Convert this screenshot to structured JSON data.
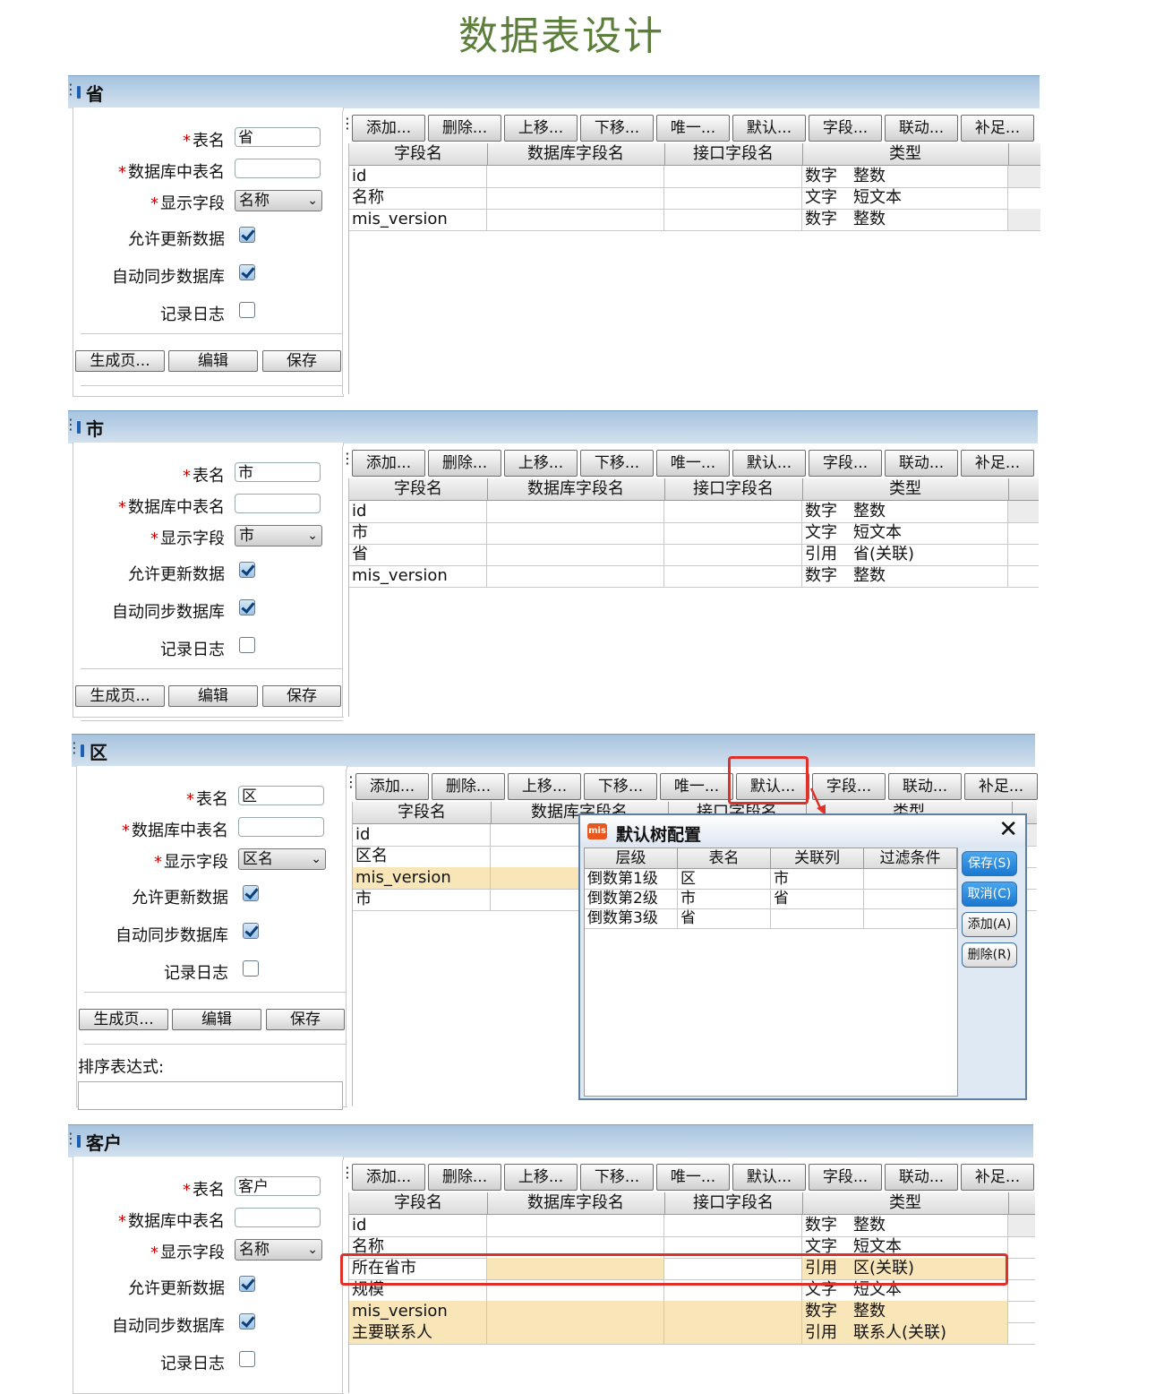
{
  "page_title": "数据表设计",
  "toolbar_buttons": [
    "添加...",
    "删除...",
    "上移...",
    "下移...",
    "唯一...",
    "默认...",
    "字段...",
    "联动...",
    "补足..."
  ],
  "form_labels": {
    "table_name": "表名",
    "db_table_name": "数据库中表名",
    "display_field": "显示字段",
    "allow_update": "允许更新数据",
    "auto_sync": "自动同步数据库",
    "log": "记录日志"
  },
  "bottom_buttons": {
    "generate": "生成页...",
    "edit": "编辑",
    "save": "保存"
  },
  "grid_headers": [
    "字段名",
    "数据库字段名",
    "接口字段名",
    "类型"
  ],
  "panels": [
    {
      "title": "省",
      "table_name": "省",
      "db_table_name": "",
      "display_field": "名称",
      "allow_update": true,
      "auto_sync": true,
      "log": false,
      "rows": [
        {
          "field": "id",
          "type": "数字　整数"
        },
        {
          "field": "名称",
          "type": "文字　短文本"
        },
        {
          "field": "mis_version",
          "type": "数字　整数"
        }
      ]
    },
    {
      "title": "市",
      "table_name": "市",
      "db_table_name": "",
      "display_field": "市",
      "allow_update": true,
      "auto_sync": true,
      "log": false,
      "rows": [
        {
          "field": "id",
          "type": "数字　整数"
        },
        {
          "field": "市",
          "type": "文字　短文本"
        },
        {
          "field": "省",
          "type": "引用　省(关联)"
        },
        {
          "field": "mis_version",
          "type": "数字　整数"
        }
      ]
    },
    {
      "title": "区",
      "table_name": "区",
      "db_table_name": "",
      "display_field": "区名",
      "allow_update": true,
      "auto_sync": true,
      "log": false,
      "sort_label": "排序表达式:",
      "rows": [
        {
          "field": "id"
        },
        {
          "field": "区名"
        },
        {
          "field": "mis_version"
        },
        {
          "field": "市"
        }
      ]
    },
    {
      "title": "客户",
      "table_name": "客户",
      "db_table_name": "",
      "display_field": "名称",
      "allow_update": true,
      "auto_sync": true,
      "log": false,
      "rows": [
        {
          "field": "id",
          "type": "数字　整数"
        },
        {
          "field": "名称",
          "type": "文字　短文本"
        },
        {
          "field": "所在省市",
          "type": "引用　区(关联)"
        },
        {
          "field": "规模",
          "type": "文字　短文本"
        },
        {
          "field": "mis_version",
          "type": "数字　整数"
        },
        {
          "field": "主要联系人",
          "type": "引用　联系人(关联)"
        }
      ]
    }
  ],
  "dialog": {
    "logo": "mis",
    "title": "默认树配置",
    "close": "✕",
    "headers": [
      "层级",
      "表名",
      "关联列",
      "过滤条件"
    ],
    "rows": [
      {
        "level": "倒数第1级",
        "table": "区",
        "column": "市",
        "filter": ""
      },
      {
        "level": "倒数第2级",
        "table": "市",
        "column": "省",
        "filter": ""
      },
      {
        "level": "倒数第3级",
        "table": "省",
        "column": "",
        "filter": ""
      }
    ],
    "buttons": {
      "save": "保存(S)",
      "cancel": "取消(C)",
      "add": "添加(A)",
      "delete": "删除(R)"
    }
  },
  "colors": {
    "accent": "#e0302a",
    "highlight": "#f8e5b8",
    "header": "#a6c3df"
  }
}
